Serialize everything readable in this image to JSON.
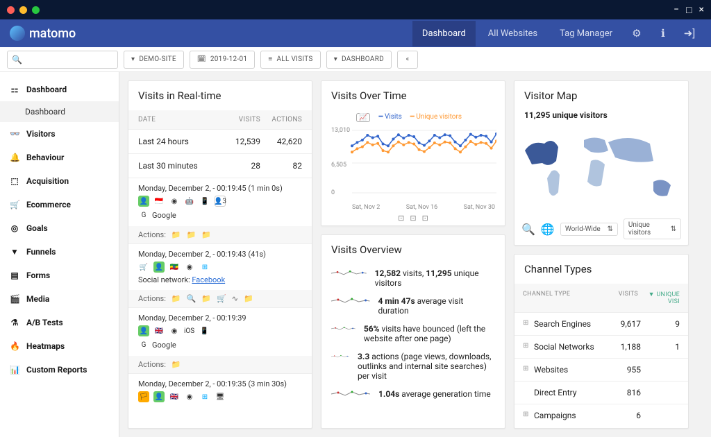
{
  "window": {
    "minimize": "−",
    "maximize": "□",
    "close": "×"
  },
  "brand": "matomo",
  "nav": {
    "dashboard": "Dashboard",
    "all_websites": "All Websites",
    "tag_manager": "Tag Manager"
  },
  "toolbar": {
    "search_placeholder": "",
    "site": "DEMO-SITE",
    "date": "2019-12-01",
    "segment": "ALL VISITS",
    "dash": "DASHBOARD"
  },
  "sidebar": {
    "items": [
      {
        "icon": "⚏",
        "label": "Dashboard"
      },
      {
        "icon": "👓",
        "label": "Visitors"
      },
      {
        "icon": "🔔",
        "label": "Behaviour"
      },
      {
        "icon": "⬚",
        "label": "Acquisition"
      },
      {
        "icon": "🛒",
        "label": "Ecommerce"
      },
      {
        "icon": "◎",
        "label": "Goals"
      },
      {
        "icon": "▼",
        "label": "Funnels"
      },
      {
        "icon": "▤",
        "label": "Forms"
      },
      {
        "icon": "🎬",
        "label": "Media"
      },
      {
        "icon": "⚗",
        "label": "A/B Tests"
      },
      {
        "icon": "🔥",
        "label": "Heatmaps"
      },
      {
        "icon": "📊",
        "label": "Custom Reports"
      }
    ],
    "sub": "Dashboard"
  },
  "realtime": {
    "title": "Visits in Real-time",
    "headers": {
      "date": "DATE",
      "visits": "VISITS",
      "actions": "ACTIONS"
    },
    "rows": [
      {
        "label": "Last 24 hours",
        "visits": "12,539",
        "actions": "42,620"
      },
      {
        "label": "Last 30 minutes",
        "visits": "28",
        "actions": "82"
      }
    ],
    "entries": [
      {
        "ts": "Monday, December 2, - 00:19:45 (1 min 0s)",
        "meta": "Google",
        "badge": "3",
        "social": ""
      },
      {
        "ts": "Monday, December 2, - 00:19:43 (41s)",
        "meta": "Social network:",
        "link": "Facebook"
      },
      {
        "ts": "Monday, December 2, - 00:19:39",
        "meta": "Google",
        "os": "iOS"
      },
      {
        "ts": "Monday, December 2, - 00:19:35 (3 min 30s)",
        "meta": ""
      }
    ],
    "actions_label": "Actions:"
  },
  "overtime": {
    "title": "Visits Over Time",
    "legend": {
      "a": "Visits",
      "b": "Unique visitors"
    },
    "yticks": [
      "13,010",
      "6,505",
      "0"
    ],
    "xticks": [
      "Sat, Nov 2",
      "Sat, Nov 16",
      "Sat, Nov 30"
    ]
  },
  "overview": {
    "title": "Visits Overview",
    "lines": [
      {
        "bold1": "12,582",
        "text1": " visits, ",
        "bold2": "11,295",
        "text2": " unique visitors"
      },
      {
        "bold1": "4 min 47s",
        "text1": " average visit duration"
      },
      {
        "bold1": "56%",
        "text1": " visits have bounced (left the website after one page)"
      },
      {
        "bold1": "3.3",
        "text1": " actions (page views, downloads, outlinks and internal site searches) per visit"
      },
      {
        "bold1": "1.04s",
        "text1": " average generation time"
      }
    ]
  },
  "map": {
    "title": "Visitor Map",
    "stat": "11,295 unique visitors",
    "sel1": "World-Wide",
    "sel2": "Unique visitors"
  },
  "channels": {
    "title": "Channel Types",
    "headers": {
      "type": "CHANNEL TYPE",
      "visits": "VISITS",
      "unique": "UNIQUE VISI"
    },
    "rows": [
      {
        "label": "Search Engines",
        "visits": "9,617",
        "unique": "9"
      },
      {
        "label": "Social Networks",
        "visits": "1,188",
        "unique": "1"
      },
      {
        "label": "Websites",
        "visits": "955",
        "unique": ""
      },
      {
        "label": "Direct Entry",
        "visits": "816",
        "unique": "",
        "noplus": true
      },
      {
        "label": "Campaigns",
        "visits": "6",
        "unique": ""
      }
    ]
  },
  "chart_data": {
    "type": "line",
    "title": "Visits Over Time",
    "xlabel": "",
    "ylabel": "",
    "ylim": [
      0,
      13010
    ],
    "x": [
      "Nov 2",
      "Nov 3",
      "Nov 4",
      "Nov 5",
      "Nov 6",
      "Nov 7",
      "Nov 8",
      "Nov 9",
      "Nov 10",
      "Nov 11",
      "Nov 12",
      "Nov 13",
      "Nov 14",
      "Nov 15",
      "Nov 16",
      "Nov 17",
      "Nov 18",
      "Nov 19",
      "Nov 20",
      "Nov 21",
      "Nov 22",
      "Nov 23",
      "Nov 24",
      "Nov 25",
      "Nov 26",
      "Nov 27",
      "Nov 28",
      "Nov 29",
      "Nov 30"
    ],
    "series": [
      {
        "name": "Visits",
        "values": [
          9800,
          10500,
          11000,
          12000,
          11500,
          11800,
          10200,
          9800,
          11200,
          12100,
          11400,
          12000,
          11700,
          10400,
          9900,
          10800,
          12000,
          11500,
          12100,
          11900,
          10600,
          9800,
          11000,
          12200,
          11600,
          12000,
          11800,
          10600,
          12300
        ]
      },
      {
        "name": "Unique visitors",
        "values": [
          8500,
          9200,
          9600,
          10500,
          10000,
          10300,
          8800,
          8500,
          9800,
          10600,
          10000,
          10500,
          10200,
          9000,
          8600,
          9400,
          10400,
          10000,
          10600,
          10400,
          9200,
          8500,
          9600,
          10700,
          10100,
          10500,
          10300,
          9300,
          10800
        ]
      }
    ]
  }
}
